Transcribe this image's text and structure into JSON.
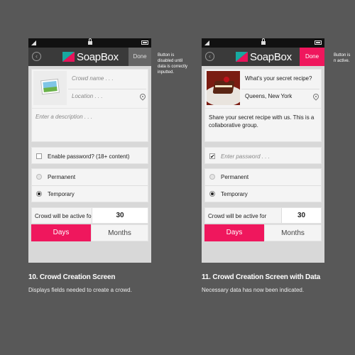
{
  "app": {
    "logo_text": "SoapBox",
    "back_glyph": "‹",
    "accent_color": "#ef175d",
    "logo_colors": [
      "#18a8a0",
      "#e8135a"
    ]
  },
  "screen1": {
    "done_label": "Done",
    "note": "Button is disabled until data is correctly inputted.",
    "crowd_name_placeholder": "Crowd name . . .",
    "location_placeholder": "Location . . .",
    "description_placeholder": "Enter a description . . .",
    "password_option": "Enable password? (18+ content)",
    "password_checked": false,
    "permanent_label": "Permanent",
    "temporary_label": "Temporary",
    "selected_duration_type": "Temporary",
    "active_for_label": "Crowd will be active for",
    "active_for_value": "30",
    "unit_days": "Days",
    "unit_months": "Months",
    "selected_unit": "Days",
    "caption_title": "10. Crowd Creation Screen",
    "caption_text": "Displays fields needed to create a crowd."
  },
  "screen2": {
    "done_label": "Done",
    "note": "Button is n active.",
    "crowd_name_value": "What's your secret recipe?",
    "location_value": "Queens, New York",
    "description_value": "Share your secret recipe with us. This is a collaborative group.",
    "password_placeholder": "Enter password . . .",
    "password_checked": true,
    "check_glyph": "✔",
    "permanent_label": "Permanent",
    "temporary_label": "Temporary",
    "selected_duration_type": "Temporary",
    "active_for_label": "Crowd will be active for",
    "active_for_value": "30",
    "unit_days": "Days",
    "unit_months": "Months",
    "selected_unit": "Days",
    "caption_title": "11. Crowd Creation Screen with Data",
    "caption_text": "Necessary data has now been indicated."
  }
}
